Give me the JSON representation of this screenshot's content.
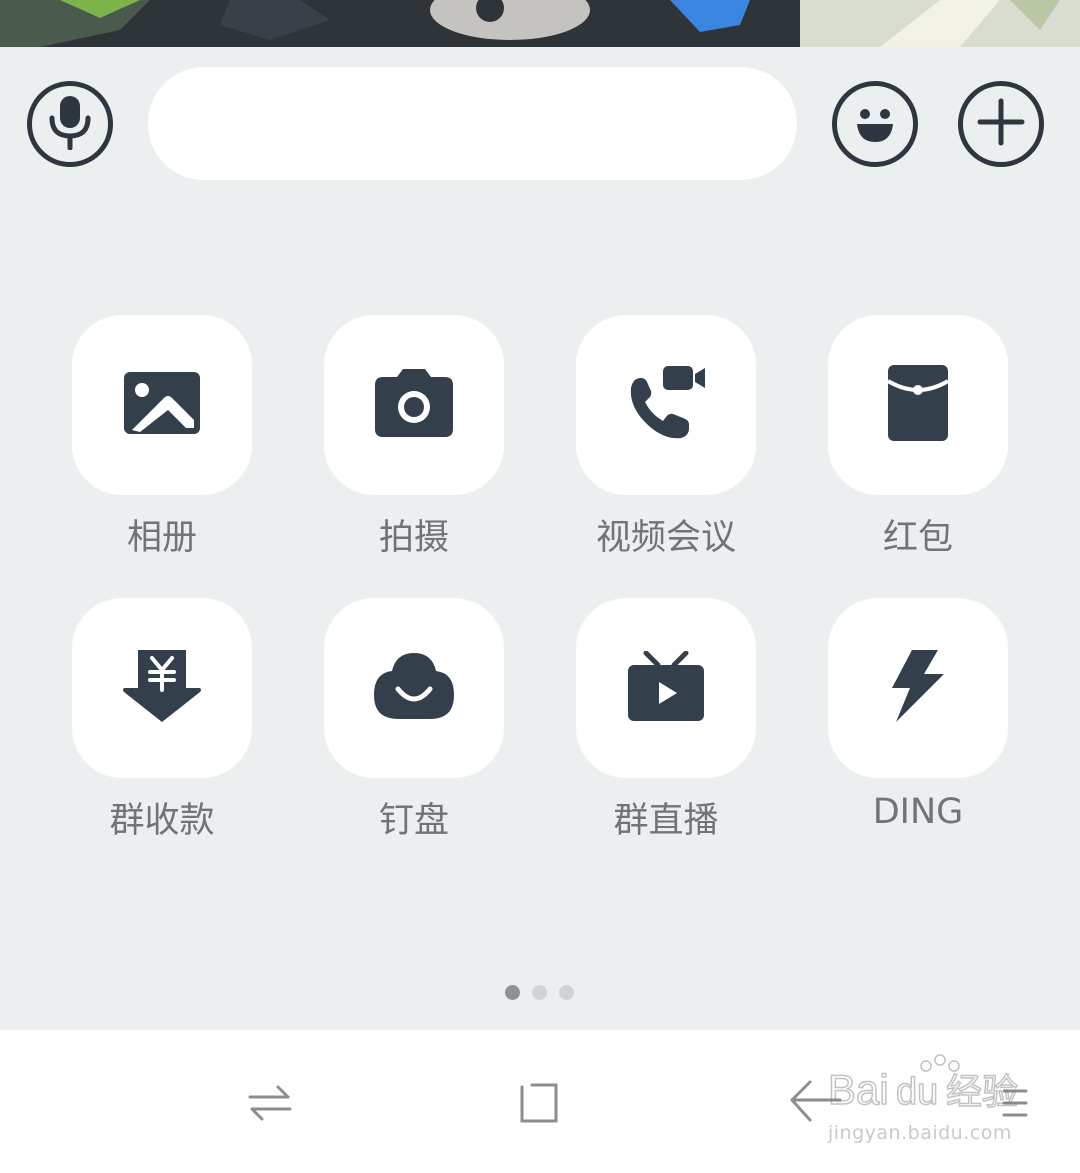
{
  "input_bar": {
    "voice_icon": "microphone-icon",
    "message_value": "",
    "emoji_icon": "smiley-icon",
    "more_icon": "plus-icon"
  },
  "grid": {
    "items": [
      {
        "label": "相册",
        "icon": "image-icon"
      },
      {
        "label": "拍摄",
        "icon": "camera-icon"
      },
      {
        "label": "视频会议",
        "icon": "video-call-icon"
      },
      {
        "label": "红包",
        "icon": "red-envelope-icon"
      },
      {
        "label": "群收款",
        "icon": "yuan-receive-icon"
      },
      {
        "label": "钉盘",
        "icon": "cloud-disk-icon"
      },
      {
        "label": "群直播",
        "icon": "live-tv-icon"
      },
      {
        "label": "DING",
        "icon": "lightning-icon"
      }
    ]
  },
  "pager": {
    "pages": 3,
    "active": 1
  },
  "navbar": {
    "recent_icon": "switch-arrows-icon",
    "home_icon": "square-home-icon",
    "back_icon": "back-arrow-icon"
  },
  "watermark": {
    "brand": "Bai度经验",
    "url": "jingyan.baidu.com"
  },
  "colors": {
    "icon": "#333f4b",
    "background": "#ebeff0",
    "label": "#6e7479"
  }
}
